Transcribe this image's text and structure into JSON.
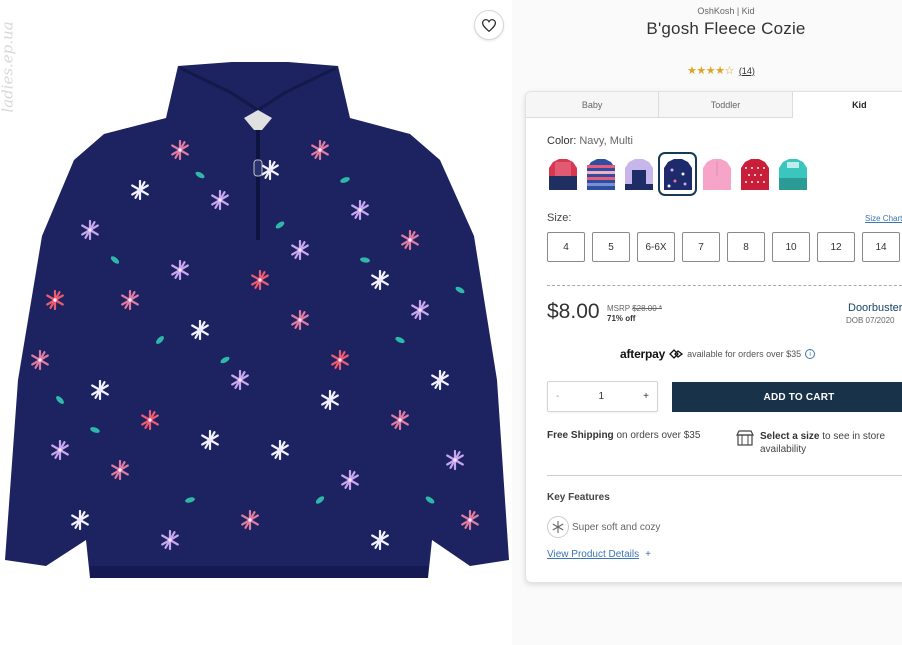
{
  "product": {
    "brand": "OshKosh | Kid",
    "title": "B'gosh Fleece Cozie",
    "rating_text": "★★★★☆",
    "review_count": "(14)"
  },
  "watermark": "ladies.ep.ua",
  "favorite_label": "♡",
  "tabs": [
    {
      "label": "Baby",
      "active": false
    },
    {
      "label": "Toddler",
      "active": false
    },
    {
      "label": "Kid",
      "active": true
    }
  ],
  "color": {
    "label": "Color:",
    "selected_value": "Navy, Multi",
    "swatches": [
      {
        "name": "red-navy",
        "colors": [
          "#d8384f",
          "#1f2f5f"
        ]
      },
      {
        "name": "striped",
        "colors": [
          "#e95b7a",
          "#2f4ea0"
        ]
      },
      {
        "name": "lavender-navy",
        "colors": [
          "#c6b6ea",
          "#1e2d66"
        ]
      },
      {
        "name": "navy-floral",
        "colors": [
          "#1d2a6b",
          "#e8a8e0"
        ],
        "selected": true
      },
      {
        "name": "pink",
        "colors": [
          "#f6a5c9",
          "#f3bcd6"
        ]
      },
      {
        "name": "red-fairisle",
        "colors": [
          "#c81e3a",
          "#f3f3f3"
        ]
      },
      {
        "name": "teal",
        "colors": [
          "#3ac5bf",
          "#2c9a95"
        ]
      }
    ]
  },
  "size": {
    "label": "Size:",
    "chart_link": "Size Chart",
    "options": [
      "4",
      "5",
      "6-6X",
      "7",
      "8",
      "10",
      "12",
      "14"
    ]
  },
  "pricing": {
    "price": "$8.00",
    "msrp_label": "MSRP",
    "msrp_value": "$28.00 *",
    "discount": "71% off",
    "promo": "Doorbuster",
    "promo_date": "DOB 07/2020"
  },
  "afterpay": {
    "logo": "afterpay",
    "text": "available for orders over $35",
    "info": "i"
  },
  "quantity": {
    "minus": "-",
    "value": "1",
    "plus": "+"
  },
  "add_to_cart": "ADD TO CART",
  "shipping": {
    "bold": "Free Shipping",
    "rest": " on orders over $35"
  },
  "store": {
    "bold": "Select a size",
    "rest": " to see in store availability"
  },
  "features": {
    "title": "Key Features",
    "items": [
      "Super soft and cozy"
    ],
    "details_link": "View Product Details",
    "details_plus": "+"
  }
}
